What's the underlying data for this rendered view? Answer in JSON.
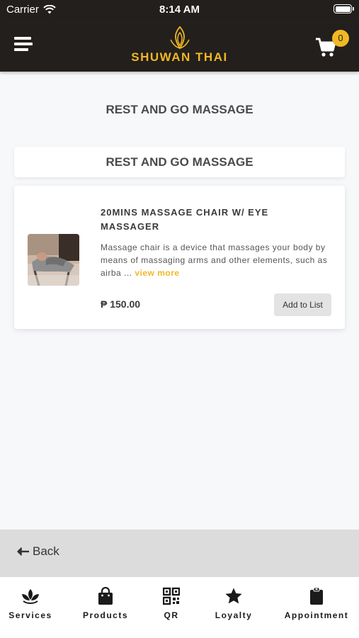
{
  "status_bar": {
    "carrier": "Carrier",
    "time": "8:14 AM"
  },
  "header": {
    "brand": "SHUWAN THAI",
    "cart_count": "0",
    "accent_color": "#f1b825",
    "bar_color": "#231f1c",
    "icons": [
      "menu-icon",
      "lotus-logo",
      "cart-icon"
    ]
  },
  "page": {
    "title": "REST AND GO MASSAGE",
    "section_title": "REST AND GO MASSAGE"
  },
  "products": [
    {
      "name": "20MINS MASSAGE CHAIR W/ EYE MASSAGER",
      "description": "Massage chair is a device that massages your body by means of massaging arms and other elements, such as airba ...",
      "view_more": "view more",
      "price": "₱ 150.00",
      "add_label": "Add to List"
    }
  ],
  "back": {
    "label": "Back"
  },
  "tabs": [
    {
      "label": "Services",
      "icon": "lotus-icon"
    },
    {
      "label": "Products",
      "icon": "shopping-bag-icon"
    },
    {
      "label": "QR",
      "icon": "qr-code-icon"
    },
    {
      "label": "Loyalty",
      "icon": "star-icon"
    },
    {
      "label": "Appointment",
      "icon": "clipboard-icon"
    }
  ]
}
